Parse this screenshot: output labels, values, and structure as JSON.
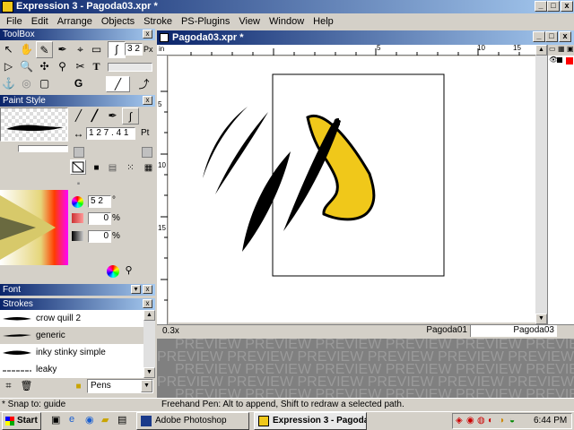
{
  "app": {
    "title": "Expression 3 - Pagoda03.xpr *"
  },
  "menu": [
    "File",
    "Edit",
    "Arrange",
    "Objects",
    "Stroke",
    "PS-Plugins",
    "View",
    "Window",
    "Help"
  ],
  "toolbox": {
    "title": "ToolBox",
    "size_value": "3 2",
    "size_unit": "Px"
  },
  "paint_style": {
    "title": "Paint Style",
    "width_value": "1 2 7 . 4 1",
    "width_unit": "Pt",
    "angle_value": "5 2",
    "angle_unit": "°",
    "pct1_value": "0",
    "pct1_unit": "%",
    "pct2_value": "0",
    "pct2_unit": "%"
  },
  "font_panel": {
    "title": "Font"
  },
  "strokes_panel": {
    "title": "Strokes",
    "items": [
      "crow quill 2",
      "generic",
      "inky stinky simple",
      "leaky"
    ],
    "selected_index": 1,
    "category_select": "Pens"
  },
  "document": {
    "title": "Pagoda03.xpr *",
    "ruler_unit": "in",
    "ruler_labels": [
      "5",
      "10",
      "15"
    ],
    "vruler_labels": [
      "5",
      "10",
      "15"
    ],
    "zoom": "0.3x",
    "tabs": [
      "Pagoda01",
      "Pagoda03"
    ],
    "active_tab": 1
  },
  "preview": {
    "watermark": "PREVIEW"
  },
  "status": {
    "left": "* Snap to: guide",
    "right": "Freehand Pen: Alt to append, Shift to redraw a selected path."
  },
  "taskbar": {
    "start": "Start",
    "tasks": [
      "Adobe Photoshop",
      "Expression 3 - Pagoda..."
    ],
    "clock": "6:44 PM"
  },
  "colors": {
    "title_dark": "#0a246a",
    "title_light": "#a6caf0",
    "yellow": "#f0c81a",
    "canvas": "#ffffff",
    "workspace": "#d4d0c8"
  }
}
